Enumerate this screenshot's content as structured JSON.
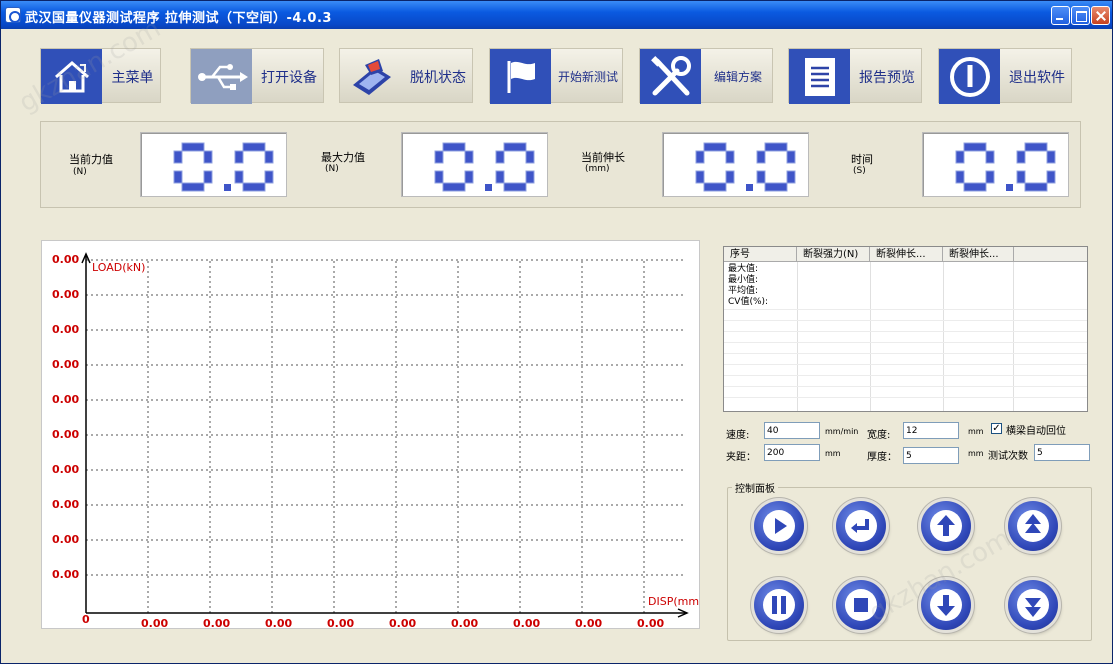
{
  "window": {
    "title": "武汉国量仪器测试程序 拉伸测试（下空间）-4.0.3"
  },
  "toolbar": [
    {
      "label": "主菜单",
      "icon": "home-icon"
    },
    {
      "label": "打开设备",
      "icon": "usb-icon"
    },
    {
      "label": "脱机状态",
      "icon": "laptop-icon"
    },
    {
      "label": "开始新测试",
      "icon": "flag-icon"
    },
    {
      "label": "编辑方案",
      "icon": "tools-icon"
    },
    {
      "label": "报告预览",
      "icon": "document-icon"
    },
    {
      "label": "退出软件",
      "icon": "power-icon"
    }
  ],
  "readouts": [
    {
      "label": "当前力值",
      "unit": "(N)",
      "value": "0.0"
    },
    {
      "label": "最大力值",
      "unit": "(N)",
      "value": "0.0"
    },
    {
      "label": "当前伸长",
      "unit": "(mm)",
      "value": "0.0"
    },
    {
      "label": "时间",
      "unit": "(S)",
      "value": "0.0"
    }
  ],
  "chart_data": {
    "type": "line",
    "ylabel": "LOAD(kN)",
    "xlabel": "DISP(mm",
    "origin_label": "0",
    "y_tick_labels": [
      "0.00",
      "0.00",
      "0.00",
      "0.00",
      "0.00",
      "0.00",
      "0.00",
      "0.00",
      "0.00",
      "0.00"
    ],
    "x_tick_labels": [
      "0.00",
      "0.00",
      "0.00",
      "0.00",
      "0.00",
      "0.00",
      "0.00",
      "0.00",
      "0.00"
    ],
    "series": [],
    "grid": true,
    "label_color": "#cc0000"
  },
  "results_table": {
    "headers": [
      "序号",
      "断裂强力(N)",
      "断裂伸长...",
      "断裂伸长..."
    ],
    "rows": [
      "最大值:",
      "最小值:",
      "平均值:",
      "CV值(%):"
    ]
  },
  "params": {
    "speed_label": "速度:",
    "speed_value": "40",
    "speed_unit": "mm/min",
    "width_label": "宽度:",
    "width_value": "12",
    "width_unit": "mm",
    "return_label": "横梁自动回位",
    "return_checked": true,
    "gauge_label": "夹距：",
    "gauge_value": "200",
    "gauge_unit": "mm",
    "thickness_label": "厚度：",
    "thickness_value": "5",
    "thickness_unit": "mm",
    "count_label": "测试次数",
    "count_value": "5"
  },
  "control_panel": {
    "title": "控制面板",
    "buttons": [
      "play-icon",
      "return-icon",
      "up-arrow-icon",
      "fast-up-icon",
      "pause-icon",
      "stop-icon",
      "down-arrow-icon",
      "fast-down-icon"
    ]
  },
  "watermark": "gkzhan.com"
}
